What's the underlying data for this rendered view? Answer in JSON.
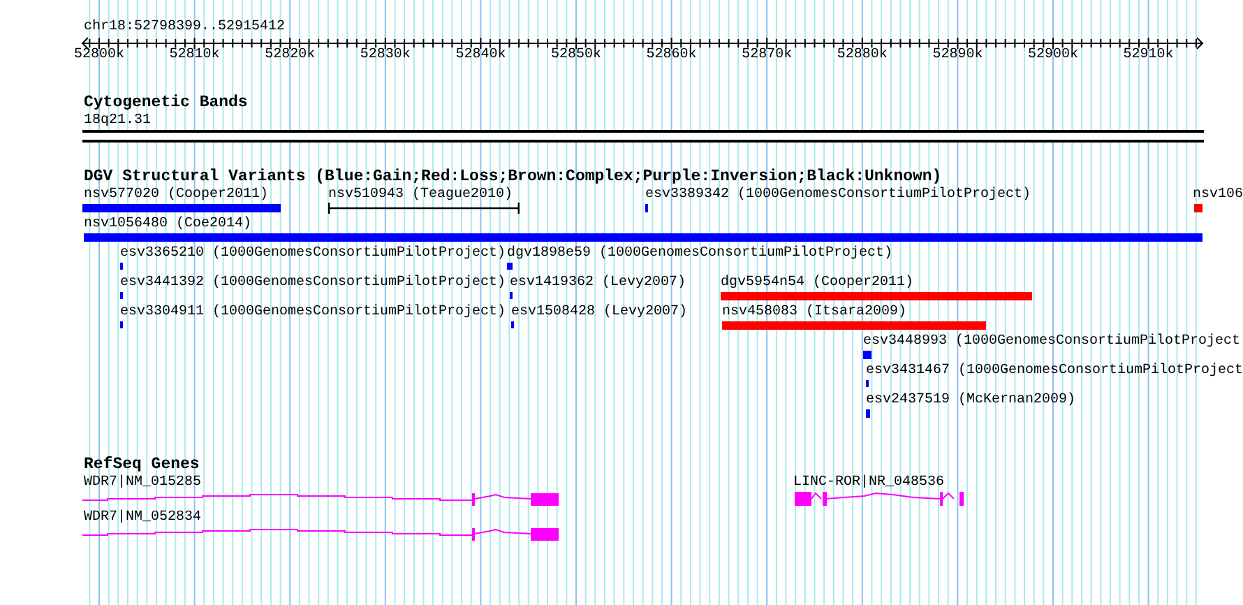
{
  "location": "chr18:52798399..52915412",
  "axis": {
    "ticks": [
      "52800k",
      "52810k",
      "52820k",
      "52830k",
      "52840k",
      "52850k",
      "52860k",
      "52870k",
      "52880k",
      "52890k",
      "52900k",
      "52910k"
    ]
  },
  "tracks": [
    {
      "kind": "bands",
      "title": "Cytogenetic Bands",
      "items": [
        {
          "label": "18q21.31"
        }
      ]
    },
    {
      "kind": "variants",
      "title": "DGV Structural Variants (Blue:Gain;Red:Loss;Brown:Complex;Purple:Inversion;Black:Unknown)",
      "features": [
        {
          "label": "nsv577020 (Cooper2011)",
          "kind": "bar",
          "color": "#0000ff"
        },
        {
          "label": "nsv510943 (Teague2010)",
          "kind": "interval",
          "color": "#000000"
        },
        {
          "label": "esv3389342 (1000GenomesConsortiumPilotProject)",
          "kind": "bar",
          "color": "#0000ff"
        },
        {
          "label": "nsv106",
          "kind": "bar",
          "color": "#ff0000"
        },
        {
          "label": "nsv1056480 (Coe2014)",
          "kind": "bar",
          "color": "#0000ff"
        },
        {
          "label": "esv3365210 (1000GenomesConsortiumPilotProject)",
          "kind": "bar",
          "color": "#0000ff"
        },
        {
          "label": "dgv1898e59 (1000GenomesConsortiumPilotProject)",
          "kind": "bar",
          "color": "#0000ff"
        },
        {
          "label": "esv3441392 (1000GenomesConsortiumPilotProject)",
          "kind": "bar",
          "color": "#0000ff"
        },
        {
          "label": "esv1419362 (Levy2007)",
          "kind": "bar",
          "color": "#0000ff"
        },
        {
          "label": "dgv5954n54 (Cooper2011)",
          "kind": "bar",
          "color": "#ff0000"
        },
        {
          "label": "esv3304911 (1000GenomesConsortiumPilotProject)",
          "kind": "bar",
          "color": "#0000ff"
        },
        {
          "label": "esv1508428 (Levy2007)",
          "kind": "bar",
          "color": "#0000ff"
        },
        {
          "label": "nsv458083 (Itsara2009)",
          "kind": "bar",
          "color": "#ff0000"
        },
        {
          "label": "esv3448993 (1000GenomesConsortiumPilotProject",
          "kind": "bar",
          "color": "#0000ff"
        },
        {
          "label": "esv3431467 (1000GenomesConsortiumPilotProject",
          "kind": "bar",
          "color": "#0000ff"
        },
        {
          "label": "esv2437519 (McKernan2009)",
          "kind": "bar",
          "color": "#0000ff"
        }
      ]
    },
    {
      "kind": "genes",
      "title": "RefSeq Genes",
      "genes": [
        {
          "label": "WDR7|NM_015285"
        },
        {
          "label": "WDR7|NM_052834"
        },
        {
          "label": "LINC-ROR|NR_048536"
        }
      ]
    }
  ]
}
